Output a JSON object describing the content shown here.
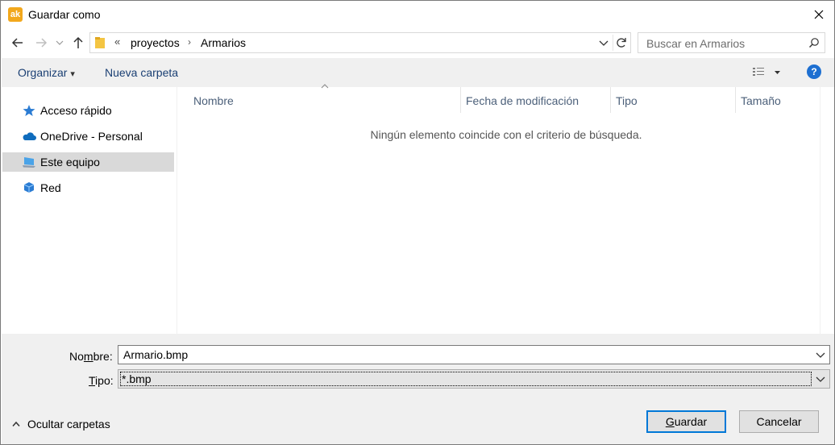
{
  "window": {
    "title": "Guardar como",
    "app_icon_text": "ak"
  },
  "address_bar": {
    "overflow": "«",
    "crumbs": [
      "proyectos",
      "Armarios"
    ],
    "separator": "›"
  },
  "search": {
    "placeholder": "Buscar en Armarios"
  },
  "toolbar": {
    "organize_label": "Organizar",
    "organize_arrow": "▾",
    "new_folder_label": "Nueva carpeta",
    "help_symbol": "?"
  },
  "nav_pane": {
    "items": [
      {
        "label": "Acceso rápido",
        "icon": "star-icon"
      },
      {
        "label": "OneDrive - Personal",
        "icon": "cloud-icon"
      },
      {
        "label": "Este equipo",
        "icon": "computer-icon",
        "selected": true
      },
      {
        "label": "Red",
        "icon": "network-icon"
      }
    ]
  },
  "file_list": {
    "columns": [
      "Nombre",
      "Fecha de modificación",
      "Tipo",
      "Tamaño"
    ],
    "empty_message": "Ningún elemento coincide con el criterio de búsqueda."
  },
  "form": {
    "name_label_pre": "No",
    "name_label_ul": "m",
    "name_label_post": "bre:",
    "name_value": "Armario.bmp",
    "type_label_ul": "T",
    "type_label_post": "ipo:",
    "type_value": "*.bmp"
  },
  "footer": {
    "hide_folders_label": "Ocultar carpetas",
    "save_ul": "G",
    "save_rest": "uardar",
    "cancel_label": "Cancelar"
  },
  "colors": {
    "accent": "#0078d7",
    "selected_bg": "#d9d9d9",
    "panel_bg": "#f0f0f0",
    "link_text": "#1a3f73"
  }
}
